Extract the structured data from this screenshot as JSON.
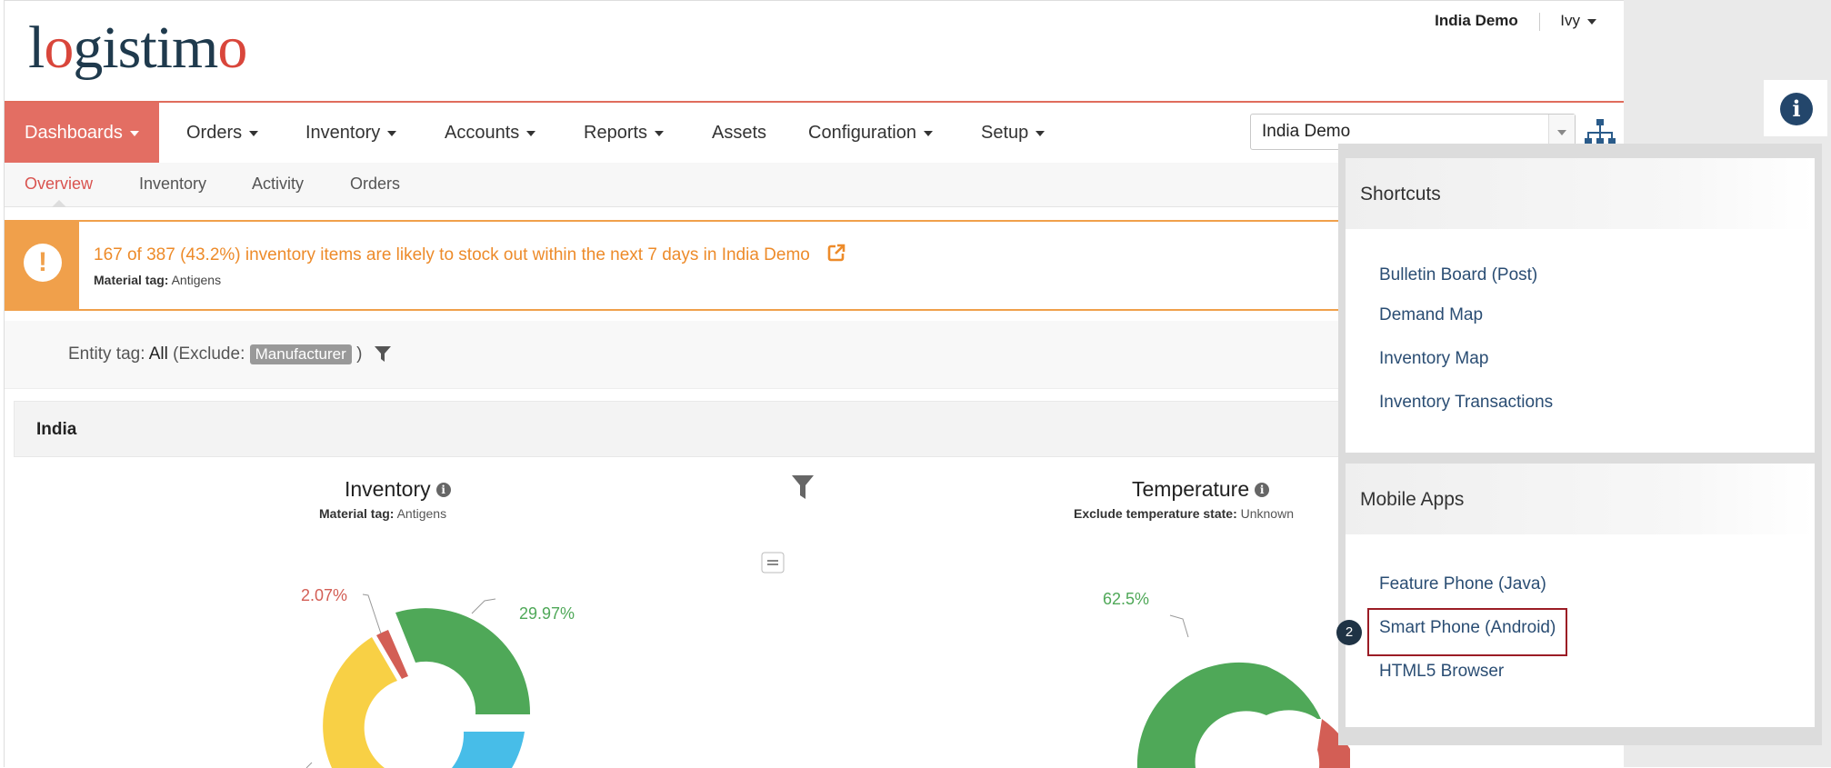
{
  "brand": {
    "logo_pre": "l",
    "logo_o1": "o",
    "logo_mid": "gistim",
    "logo_o2": "o"
  },
  "header": {
    "domain_name": "India Demo",
    "user": "Ivy"
  },
  "nav": {
    "items": [
      "Dashboards",
      "Orders",
      "Inventory",
      "Accounts",
      "Reports",
      "Assets",
      "Configuration",
      "Setup"
    ],
    "domain_select_value": "India Demo"
  },
  "subnav": {
    "items": [
      "Overview",
      "Inventory",
      "Activity",
      "Orders"
    ]
  },
  "alert": {
    "message": "167 of 387 (43.2%) inventory items are likely to stock out within the next 7 days in India Demo",
    "tag_label": "Material tag:",
    "tag_value": "Antigens"
  },
  "filter": {
    "prefix": "Entity tag:",
    "value": "All",
    "exclude_label": "(Exclude:",
    "exclude_tag": "Manufacturer",
    "suffix": ")"
  },
  "section": {
    "title": "India"
  },
  "inventory_chart": {
    "title": "Inventory",
    "sub_label": "Material tag:",
    "sub_value": "Antigens",
    "labels": [
      "2.07%",
      "29.97%"
    ]
  },
  "temperature_chart": {
    "title": "Temperature",
    "sub_label": "Exclude temperature state:",
    "sub_value": "Unknown",
    "labels": [
      "62.5%"
    ]
  },
  "shortcuts": {
    "title": "Shortcuts",
    "links": [
      "Bulletin Board  (Post)",
      "Demand Map",
      "Inventory Map",
      "Inventory Transactions"
    ]
  },
  "mobile_apps": {
    "title": "Mobile Apps",
    "links": [
      "Feature Phone (Java)",
      "Smart Phone (Android)",
      "HTML5 Browser"
    ]
  },
  "callout": {
    "step": "2"
  },
  "colors": {
    "accent": "#e36e63",
    "alert": "#f0a04b",
    "link": "#2a4d73",
    "green": "#4fa858",
    "yellow": "#f8d045",
    "blue": "#47bde8",
    "red": "#d35e55"
  }
}
